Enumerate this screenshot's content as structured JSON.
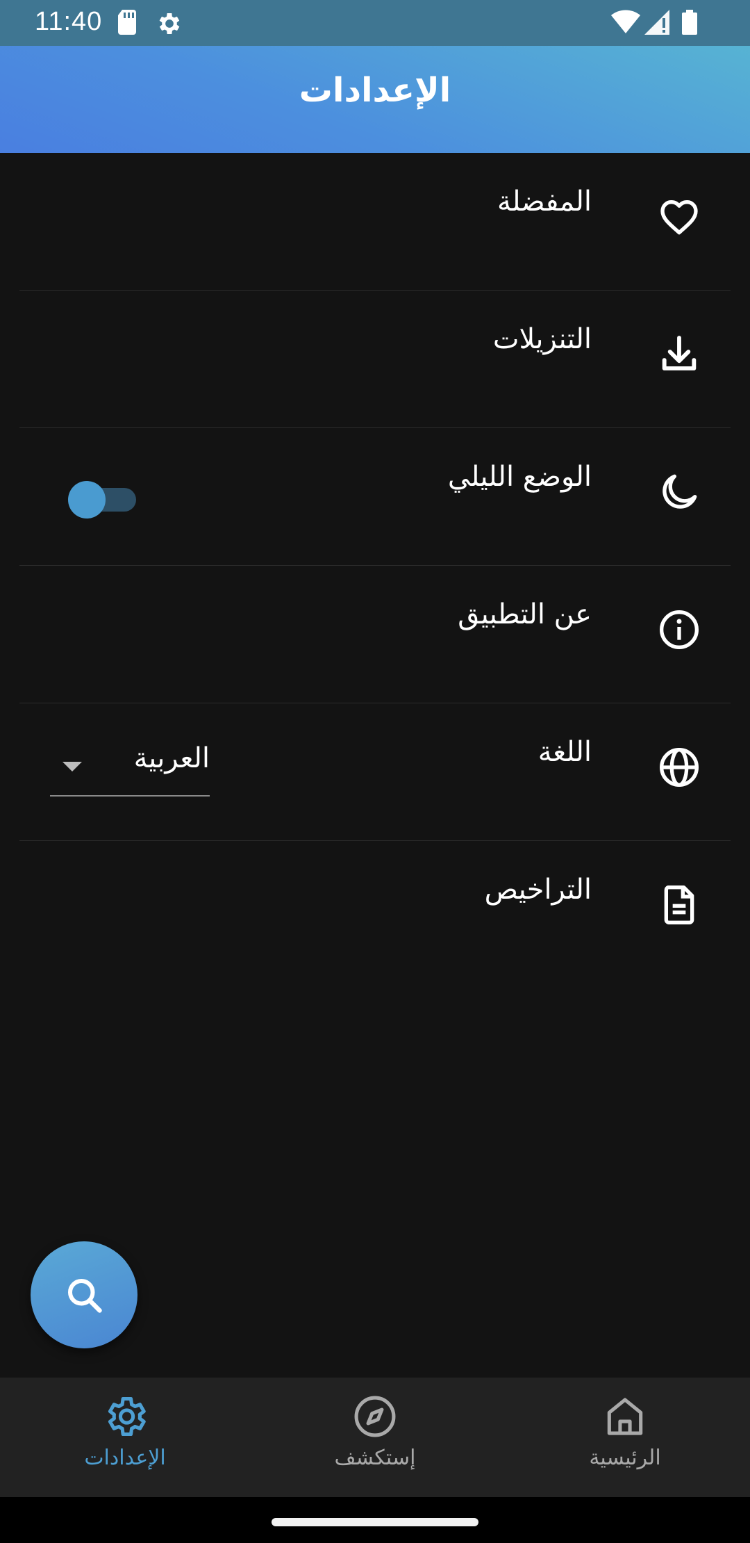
{
  "status_bar": {
    "time": "11:40",
    "icons": [
      "sd-card-icon",
      "settings-gear-icon",
      "wifi-icon",
      "signal-icon",
      "battery-icon"
    ]
  },
  "app_bar": {
    "title": "الإعدادات"
  },
  "settings": {
    "items": [
      {
        "label": "المفضلة",
        "icon": "heart-icon"
      },
      {
        "label": "التنزيلات",
        "icon": "download-icon"
      },
      {
        "label": "الوضع الليلي",
        "icon": "moon-icon",
        "toggle_on": false
      },
      {
        "label": "عن التطبيق",
        "icon": "info-icon"
      },
      {
        "label": "اللغة",
        "icon": "globe-icon",
        "dropdown_value": "العربية"
      },
      {
        "label": "التراخيص",
        "icon": "document-icon"
      }
    ]
  },
  "fab": {
    "icon": "search-icon"
  },
  "bottom_nav": {
    "items": [
      {
        "label": "الإعدادات",
        "icon": "settings-icon",
        "active": true
      },
      {
        "label": "إستكشف",
        "icon": "compass-icon",
        "active": false
      },
      {
        "label": "الرئيسية",
        "icon": "home-icon",
        "active": false
      }
    ]
  },
  "colors": {
    "accent": "#4d9fd3",
    "background": "#131313",
    "nav_background": "#222222"
  }
}
